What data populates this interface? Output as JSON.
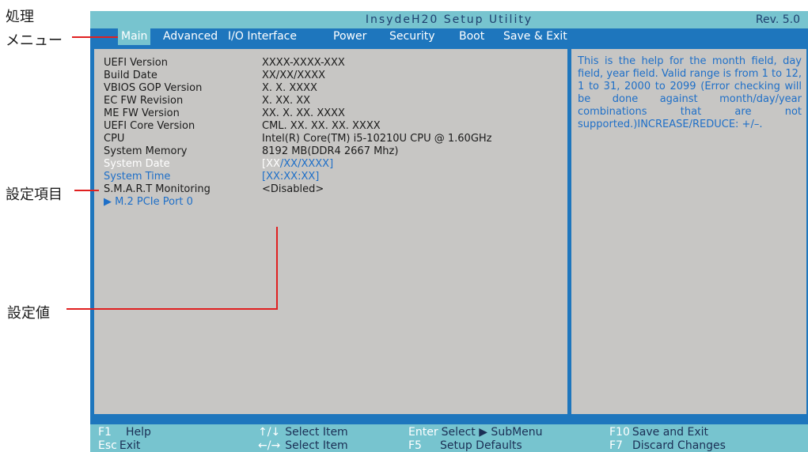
{
  "annotations": {
    "processing_menu_line1": "処理",
    "processing_menu_line2": "メニュー",
    "setting_item": "設定項目",
    "setting_value": "設定値"
  },
  "bios": {
    "title": "InsydeH20 Setup Utility",
    "revision": "Rev. 5.0",
    "menu": [
      "Main",
      "Advanced",
      "I/O Interface",
      "Power",
      "Security",
      "Boot",
      "Save & Exit"
    ],
    "active_menu": "Main",
    "rows": [
      {
        "label": "UEFI Version",
        "value": "XXXX-XXXX-XXX"
      },
      {
        "label": "Build Date",
        "value": "XX/XX/XXXX"
      },
      {
        "label": "VBIOS GOP Version",
        "value": "X. X. XXXX"
      },
      {
        "label": "EC FW Revision",
        "value": "X. XX. XX"
      },
      {
        "label": "ME FW Version",
        "value": "XX. X. XX. XXXX"
      },
      {
        "label": "UEFI Core Version",
        "value": "CML. XX. XX. XX. XXXX"
      },
      {
        "label": "CPU",
        "value": "Intel(R) Core(TM) i5-10210U CPU @ 1.60GHz"
      },
      {
        "label": "System Memory",
        "value": "8192 MB(DDR4 2667 Mhz)"
      },
      {
        "label": "System Date",
        "value_cursor": "[XX",
        "value_rest": "/XX/XXXX]"
      },
      {
        "label": "System Time",
        "value": "[XX:XX:XX]"
      },
      {
        "label": "S.M.A.R.T Monitoring",
        "value": "<Disabled>"
      },
      {
        "label": "▶ M.2 PCIe Port 0"
      }
    ],
    "help_text": "This is the help for the month field, day field, year field. Valid range is from 1 to 12, 1 to 31, 2000 to 2099 (Error checking will be done against month/day/year combinations that are not supported.)INCREASE/REDUCE: +/–.",
    "footer": [
      {
        "key": "F1",
        "desc": "Help"
      },
      {
        "key": "Esc",
        "desc": "Exit"
      },
      {
        "key": "↑/↓",
        "desc": "Select  Item"
      },
      {
        "key": "←/→",
        "desc": "Select  Item"
      },
      {
        "key": "Enter",
        "desc": "Select ▶ SubMenu"
      },
      {
        "key": "F5",
        "desc": "Setup  Defaults"
      },
      {
        "key": "F10",
        "desc": "Save  and  Exit"
      },
      {
        "key": "F7",
        "desc": "Discard  Changes"
      }
    ]
  },
  "colors": {
    "menubar": "#1e76bd",
    "frame_teal": "#77c4cf",
    "pane_gray": "#c7c6c4",
    "link_blue": "#1e6fc8",
    "annotation_red": "#e02020"
  }
}
